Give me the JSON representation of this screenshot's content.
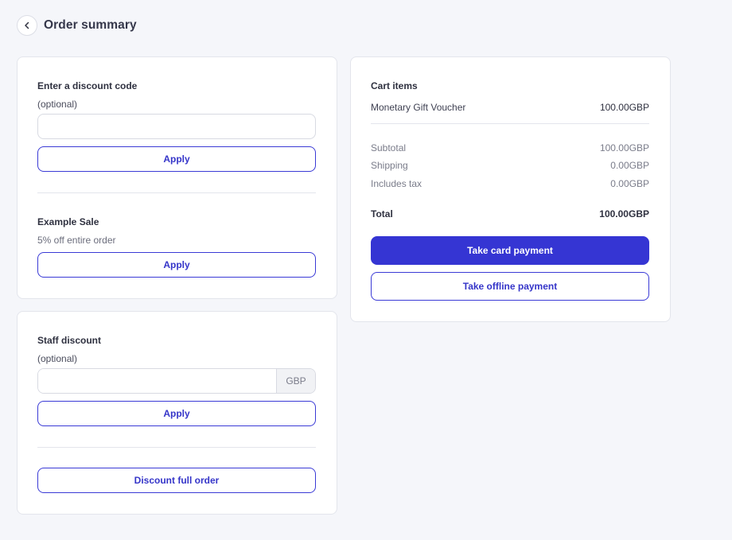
{
  "header": {
    "title": "Order summary",
    "back_icon": "chevron-left-icon"
  },
  "discount_code": {
    "label": "Enter a discount code",
    "optional": "(optional)",
    "input_value": "",
    "apply_label": "Apply"
  },
  "promo": {
    "title": "Example Sale",
    "description": "5% off entire order",
    "apply_label": "Apply"
  },
  "staff_discount": {
    "label": "Staff discount",
    "optional": "(optional)",
    "input_value": "",
    "currency": "GBP",
    "apply_label": "Apply",
    "full_order_label": "Discount full order"
  },
  "cart": {
    "title": "Cart items",
    "items": [
      {
        "name": "Monetary Gift Voucher",
        "price": "100.00GBP"
      }
    ],
    "subtotal": {
      "label": "Subtotal",
      "value": "100.00GBP"
    },
    "shipping": {
      "label": "Shipping",
      "value": "0.00GBP"
    },
    "tax": {
      "label": "Includes tax",
      "value": "0.00GBP"
    },
    "total": {
      "label": "Total",
      "value": "100.00GBP"
    },
    "card_payment_label": "Take card payment",
    "offline_payment_label": "Take offline payment"
  },
  "colors": {
    "accent": "#3535d3",
    "background": "#f5f6fa",
    "card": "#ffffff",
    "border": "#e3e5ec"
  }
}
